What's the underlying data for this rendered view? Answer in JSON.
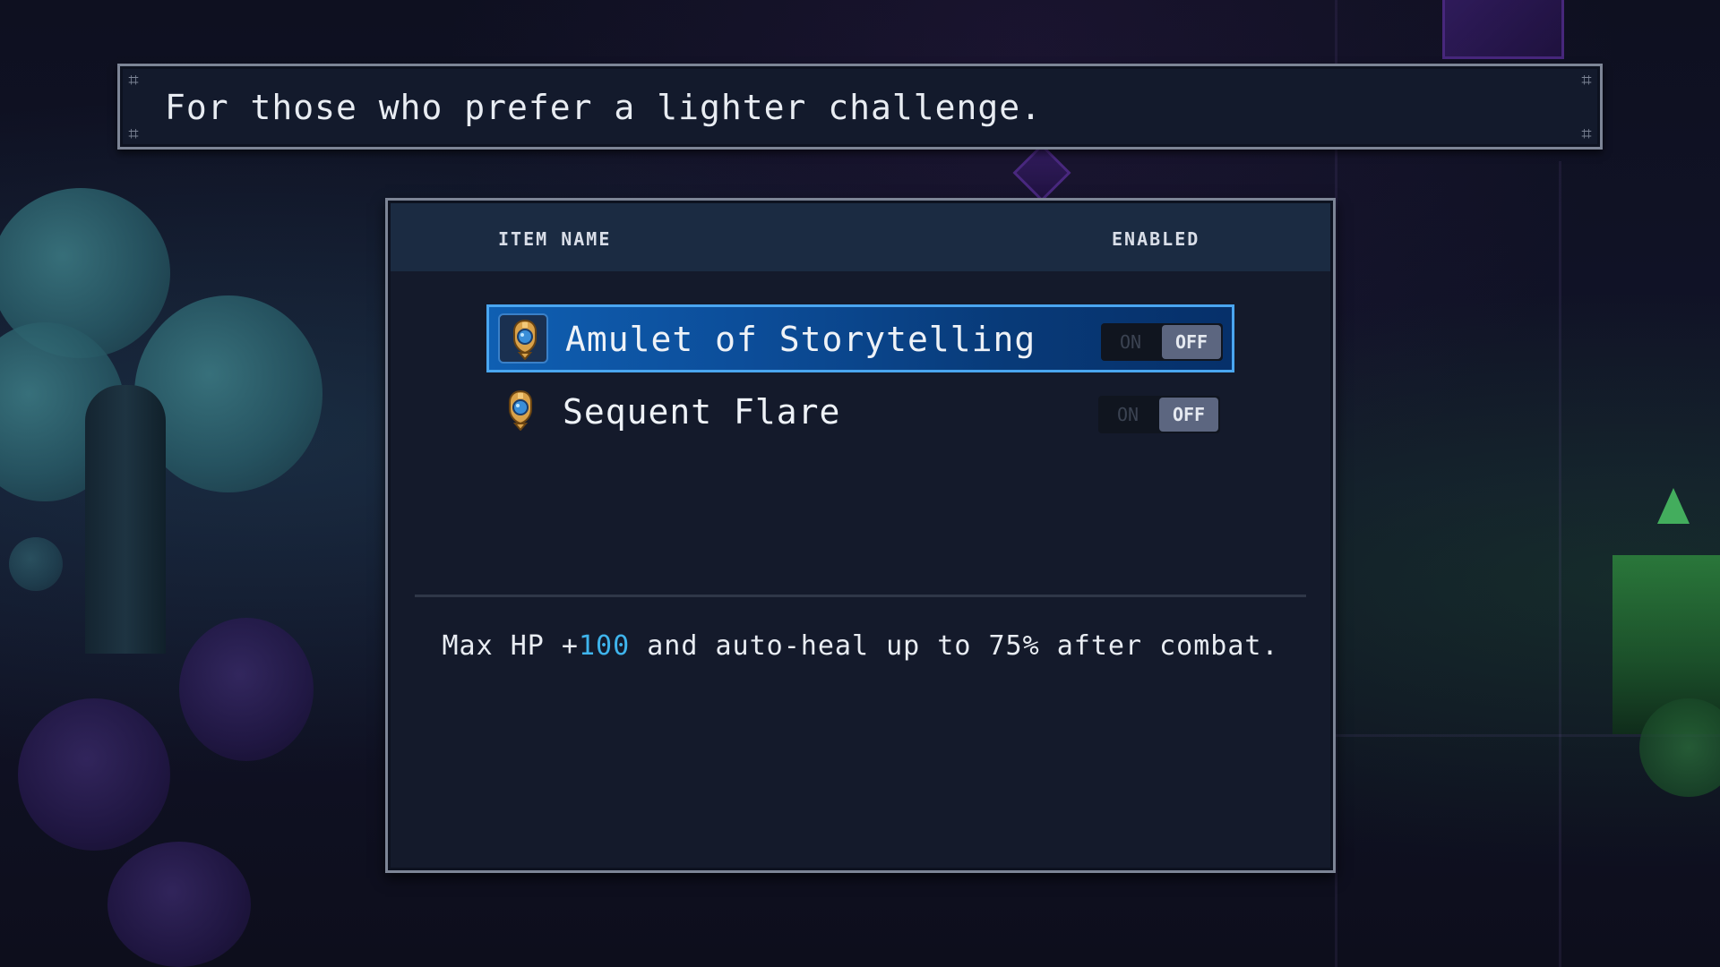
{
  "hint": {
    "text": "For those who prefer a lighter challenge."
  },
  "panel": {
    "column_name": "ITEM NAME",
    "column_enabled": "ENABLED",
    "items": [
      {
        "label": "Amulet of Storytelling",
        "icon": "amulet-icon",
        "selected": true,
        "toggle_on_label": "ON",
        "toggle_off_label": "OFF",
        "state": "OFF"
      },
      {
        "label": "Sequent Flare",
        "icon": "amulet-icon",
        "selected": false,
        "toggle_on_label": "ON",
        "toggle_off_label": "OFF",
        "state": "OFF"
      }
    ],
    "description": {
      "prefix": "Max HP +",
      "hp_value": "100",
      "suffix": " and auto-heal up to 75% after combat."
    }
  },
  "colors": {
    "selected_row": "#0c4d99",
    "selected_border": "#4aa6f0",
    "highlight_text": "#3fb4ec",
    "panel_bg": "#141a2b",
    "header_bg": "#1b2b42"
  },
  "cursor": {
    "icon": "pointing-hand-icon"
  }
}
